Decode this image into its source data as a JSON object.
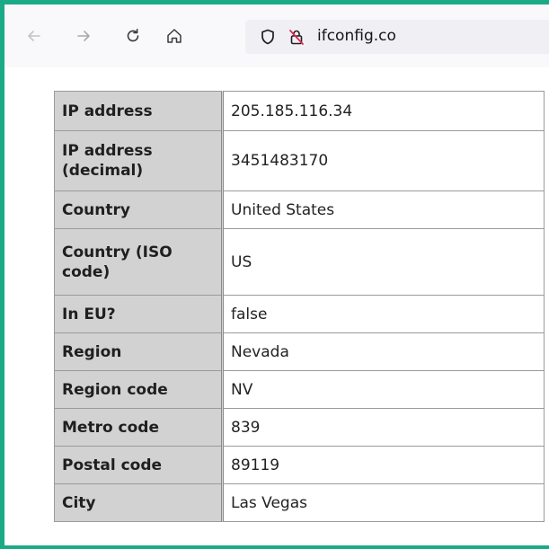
{
  "browser": {
    "url": "ifconfig.co",
    "icons": {
      "back": "arrow-left-icon",
      "forward": "arrow-right-icon",
      "reload": "reload-icon",
      "home": "home-icon",
      "tracking": "shield-icon",
      "security": "insecure-lock-icon"
    }
  },
  "colors": {
    "frame": "#1aaa86",
    "key_cell": "#d2d2d2",
    "border": "#9a9a9a"
  },
  "table": {
    "rows": [
      {
        "key": "IP address",
        "value": "205.185.116.34"
      },
      {
        "key": "IP address (decimal)",
        "value": "3451483170"
      },
      {
        "key": "Country",
        "value": "United States"
      },
      {
        "key": "Country (ISO code)",
        "value": "US"
      },
      {
        "key": "In EU?",
        "value": "false"
      },
      {
        "key": "Region",
        "value": "Nevada"
      },
      {
        "key": "Region code",
        "value": "NV"
      },
      {
        "key": "Metro code",
        "value": "839"
      },
      {
        "key": "Postal code",
        "value": "89119"
      },
      {
        "key": "City",
        "value": "Las Vegas"
      }
    ]
  }
}
